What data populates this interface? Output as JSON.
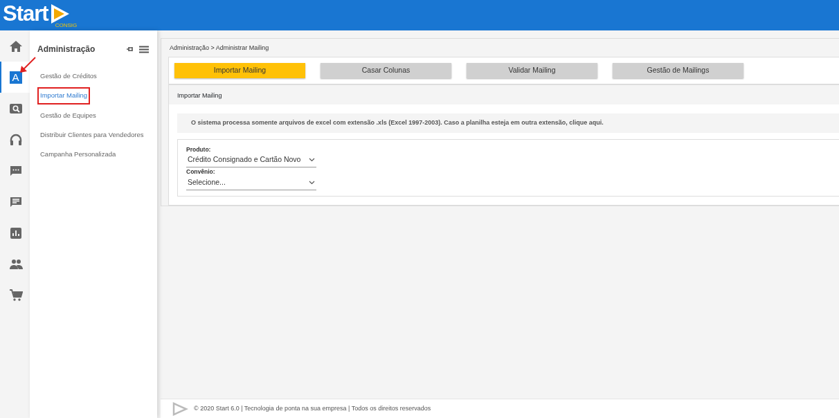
{
  "logo": {
    "text": "Start",
    "subtext": "CONSIG"
  },
  "rail": [
    {
      "kind": "home",
      "selected": false
    },
    {
      "kind": "letter",
      "label": "A",
      "selected": true
    },
    {
      "kind": "search",
      "selected": false
    },
    {
      "kind": "headset",
      "selected": false
    },
    {
      "kind": "chat-dots",
      "selected": false
    },
    {
      "kind": "chat-lines",
      "selected": false
    },
    {
      "kind": "chart",
      "selected": false
    },
    {
      "kind": "people",
      "selected": false
    },
    {
      "kind": "cart",
      "selected": false
    }
  ],
  "submenu": {
    "title": "Administração",
    "items": [
      {
        "label": "Gestão de Créditos",
        "selected": false,
        "highlighted": false
      },
      {
        "label": "Importar Mailing",
        "selected": true,
        "highlighted": true
      },
      {
        "label": "Gestão de Equipes",
        "selected": false,
        "highlighted": false
      },
      {
        "label": "Distribuir Clientes para Vendedores",
        "selected": false,
        "highlighted": false
      },
      {
        "label": "Campanha Personalizada",
        "selected": false,
        "highlighted": false
      }
    ]
  },
  "breadcrumb": "Administração > Administrar Mailing",
  "steps": [
    {
      "label": "Importar Mailing",
      "selected": true
    },
    {
      "label": "Casar Colunas",
      "selected": false
    },
    {
      "label": "Validar Mailing",
      "selected": false
    },
    {
      "label": "Gestão de Mailings",
      "selected": false
    }
  ],
  "section_title": "Importar Mailing",
  "notice": "O sistema processa somente arquivos de excel com extensão .xls (Excel 1997-2003). Caso a planilha esteja em outra extensão, clique aqui.",
  "fields": [
    {
      "label": "Produto:",
      "value": "Crédito Consignado e Cartão Novo"
    },
    {
      "label": "Convênio:",
      "value": "Selecione..."
    }
  ],
  "footer": "© 2020 Start 6.0 | Tecnologia de ponta na sua empresa | Todos os direitos reservados"
}
